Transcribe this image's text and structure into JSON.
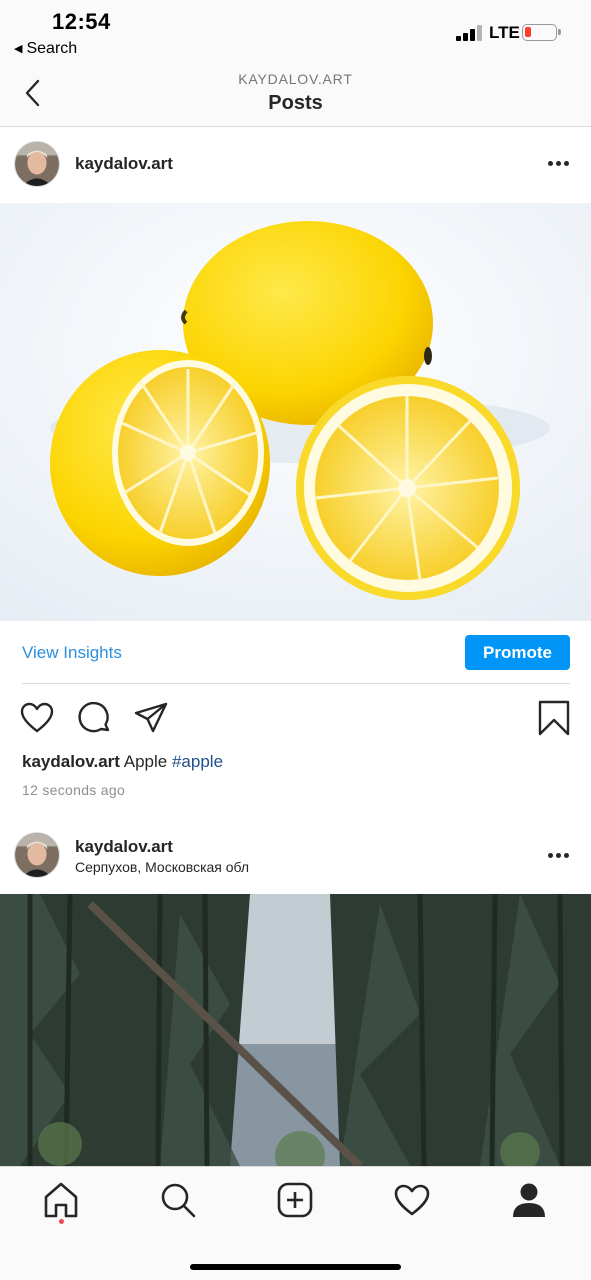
{
  "status_bar": {
    "time": "12:54",
    "back_app": "Search",
    "network": "LTE",
    "battery_level": 0.2,
    "battery_color": "#ff3b30"
  },
  "nav": {
    "account": "KAYDALOV.ART",
    "title": "Posts",
    "back_icon": "chevron-left-icon"
  },
  "posts": [
    {
      "username": "kaydalov.art",
      "location": "",
      "photo": "lemons",
      "insights_label": "View Insights",
      "promote_label": "Promote",
      "caption_user": "kaydalov.art",
      "caption_text": " Apple ",
      "caption_hashtag": "#apple",
      "timestamp": "12 seconds ago"
    },
    {
      "username": "kaydalov.art",
      "location": "Серпухов, Московская обл",
      "photo": "forest"
    }
  ],
  "actions": [
    "heart-icon",
    "comment-icon",
    "share-icon",
    "bookmark-icon"
  ],
  "tab_bar": {
    "items": [
      "home-icon",
      "search-icon",
      "add-post-icon",
      "activity-heart-icon",
      "profile-icon"
    ],
    "active": "home-icon",
    "notification_dot_color": "#ed4956"
  },
  "colors": {
    "link_blue": "#2c8fe0",
    "promote_blue": "#0095f6",
    "hashtag": "#1f4e89",
    "muted": "#8e8e8e"
  }
}
